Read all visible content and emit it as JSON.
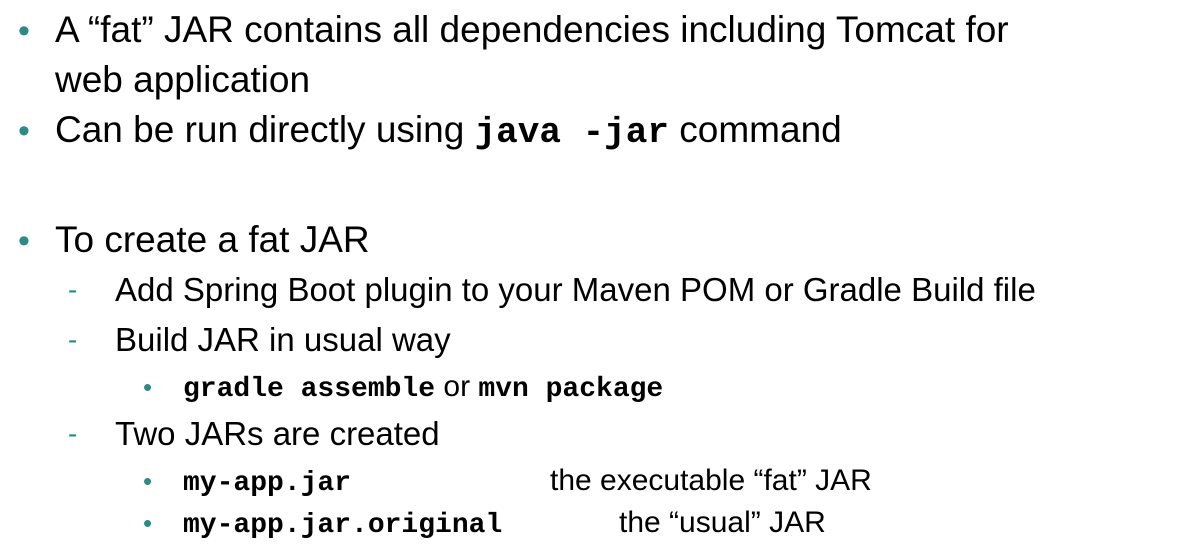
{
  "slide": {
    "bullets": [
      {
        "line1": "A “fat” JAR contains all dependencies including Tomcat for",
        "line2": "web application"
      },
      {
        "prefix": "Can be run directly using ",
        "code": "java -jar",
        "suffix": " command"
      },
      {
        "text": "To create a fat JAR",
        "sub": [
          {
            "text": "Add Spring Boot plugin to your Maven POM or Gradle Build file"
          },
          {
            "text": "Build JAR in usual way",
            "sub": [
              {
                "code1": "gradle assemble",
                "middle": " or ",
                "code2": "mvn package"
              }
            ]
          },
          {
            "text": "Two JARs are created",
            "sub": [
              {
                "code": "my-app.jar",
                "desc": "the executable “fat” JAR"
              },
              {
                "code": "my-app.jar.original",
                "desc": "the “usual” JAR"
              }
            ]
          }
        ]
      }
    ]
  },
  "colors": {
    "bullet": "#2e8a87",
    "text": "#000000",
    "background": "#ffffff"
  }
}
